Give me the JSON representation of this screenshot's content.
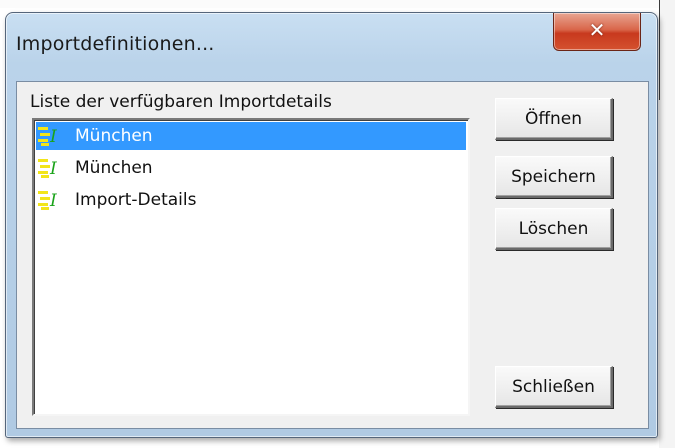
{
  "dialog": {
    "title": "Importdefinitionen..."
  },
  "list": {
    "label": "Liste der verfügbaren Importdetails",
    "items": [
      {
        "label": "München",
        "selected": true,
        "icon": "import-definition-icon"
      },
      {
        "label": "München",
        "selected": false,
        "icon": "import-definition-icon"
      },
      {
        "label": "Import-Details",
        "selected": false,
        "icon": "import-definition-icon"
      }
    ]
  },
  "buttons": {
    "open": "Öffnen",
    "save": "Speichern",
    "delete": "Löschen",
    "close": "Schließen"
  },
  "colors": {
    "selection": "#3399ff",
    "close_button": "#c8391e",
    "window_frame": "#b9d1ea"
  }
}
